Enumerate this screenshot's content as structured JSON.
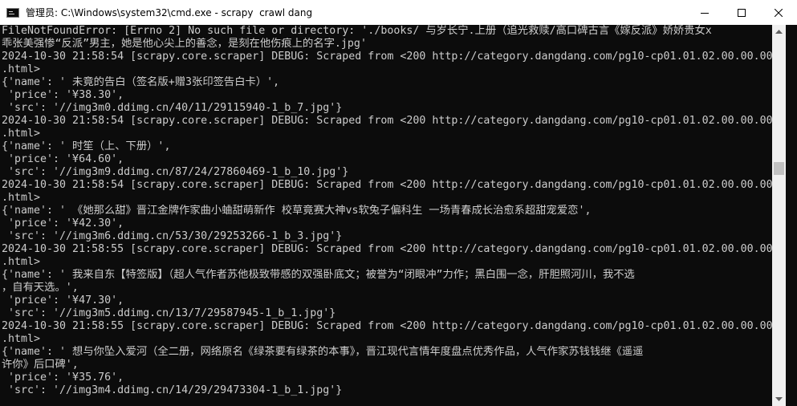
{
  "window": {
    "title": "管理员: C:\\Windows\\system32\\cmd.exe - scrapy  crawl dang"
  },
  "colors": {
    "console_bg": "#0c0c0c",
    "console_fg": "#cccccc",
    "titlebar_bg": "#ffffff",
    "scrollbar_bg": "#f0f0f0",
    "scroll_thumb": "#c1c1c1"
  },
  "icons": {
    "app": "cmd-icon",
    "minimize": "minimize-icon",
    "maximize": "maximize-icon",
    "close": "close-icon",
    "scroll_up": "scroll-up-arrow-icon",
    "scroll_down": "scroll-down-arrow-icon"
  },
  "console": {
    "lines": [
      "FileNotFoundError: [Errno 2] No such file or directory: './books/ 与岁长宁.上册（追光救赎/高口碑古言《嫁反派》娇娇贵女x",
      "乖张美强惨“反派”男主，她是他心尖上的善念，是刻在他伤痕上的名字.jpg'",
      "2024-10-30 21:58:54 [scrapy.core.scraper] DEBUG: Scraped from <200 http://category.dangdang.com/pg10-cp01.01.02.00.00.00",
      ".html>",
      "{'name': ' 未竟的告白（签名版+赠3张印签告白卡）',",
      " 'price': '¥38.30',",
      " 'src': '//img3m0.ddimg.cn/40/11/29115940-1_b_7.jpg'}",
      "2024-10-30 21:58:54 [scrapy.core.scraper] DEBUG: Scraped from <200 http://category.dangdang.com/pg10-cp01.01.02.00.00.00",
      ".html>",
      "{'name': ' 时笙（上、下册）',",
      " 'price': '¥64.60',",
      " 'src': '//img3m9.ddimg.cn/87/24/27860469-1_b_10.jpg'}",
      "2024-10-30 21:58:54 [scrapy.core.scraper] DEBUG: Scraped from <200 http://category.dangdang.com/pg10-cp01.01.02.00.00.00",
      ".html>",
      "{'name': ' 《她那么甜》晋江金牌作家曲小蛐甜萌新作 校草竟赛大神vs软兔子偏科生 一场青春成长治愈系超甜宠爱恋',",
      " 'price': '¥42.30',",
      " 'src': '//img3m6.ddimg.cn/53/30/29253266-1_b_3.jpg'}",
      "2024-10-30 21:58:55 [scrapy.core.scraper] DEBUG: Scraped from <200 http://category.dangdang.com/pg10-cp01.01.02.00.00.00",
      ".html>",
      "{'name': ' 我来自东【特签版】（超人气作者苏他极致带感的双强卧底文；被誉为“闭眼冲”力作；黑白围一念，肝胆照河川，我不选",
      "，自有天选。',",
      " 'price': '¥47.30',",
      " 'src': '//img3m5.ddimg.cn/13/7/29587945-1_b_1.jpg'}",
      "2024-10-30 21:58:55 [scrapy.core.scraper] DEBUG: Scraped from <200 http://category.dangdang.com/pg10-cp01.01.02.00.00.00",
      ".html>",
      "{'name': ' 想与你坠入爱河（全二册，网络原名《绿茶要有绿茶的本事》，晋江现代言情年度盘点优秀作品，人气作家苏钱钱继《遥遥",
      "许你》后口碑',",
      " 'price': '¥35.76',",
      " 'src': '//img3m4.ddimg.cn/14/29/29473304-1_b_1.jpg'}"
    ]
  }
}
